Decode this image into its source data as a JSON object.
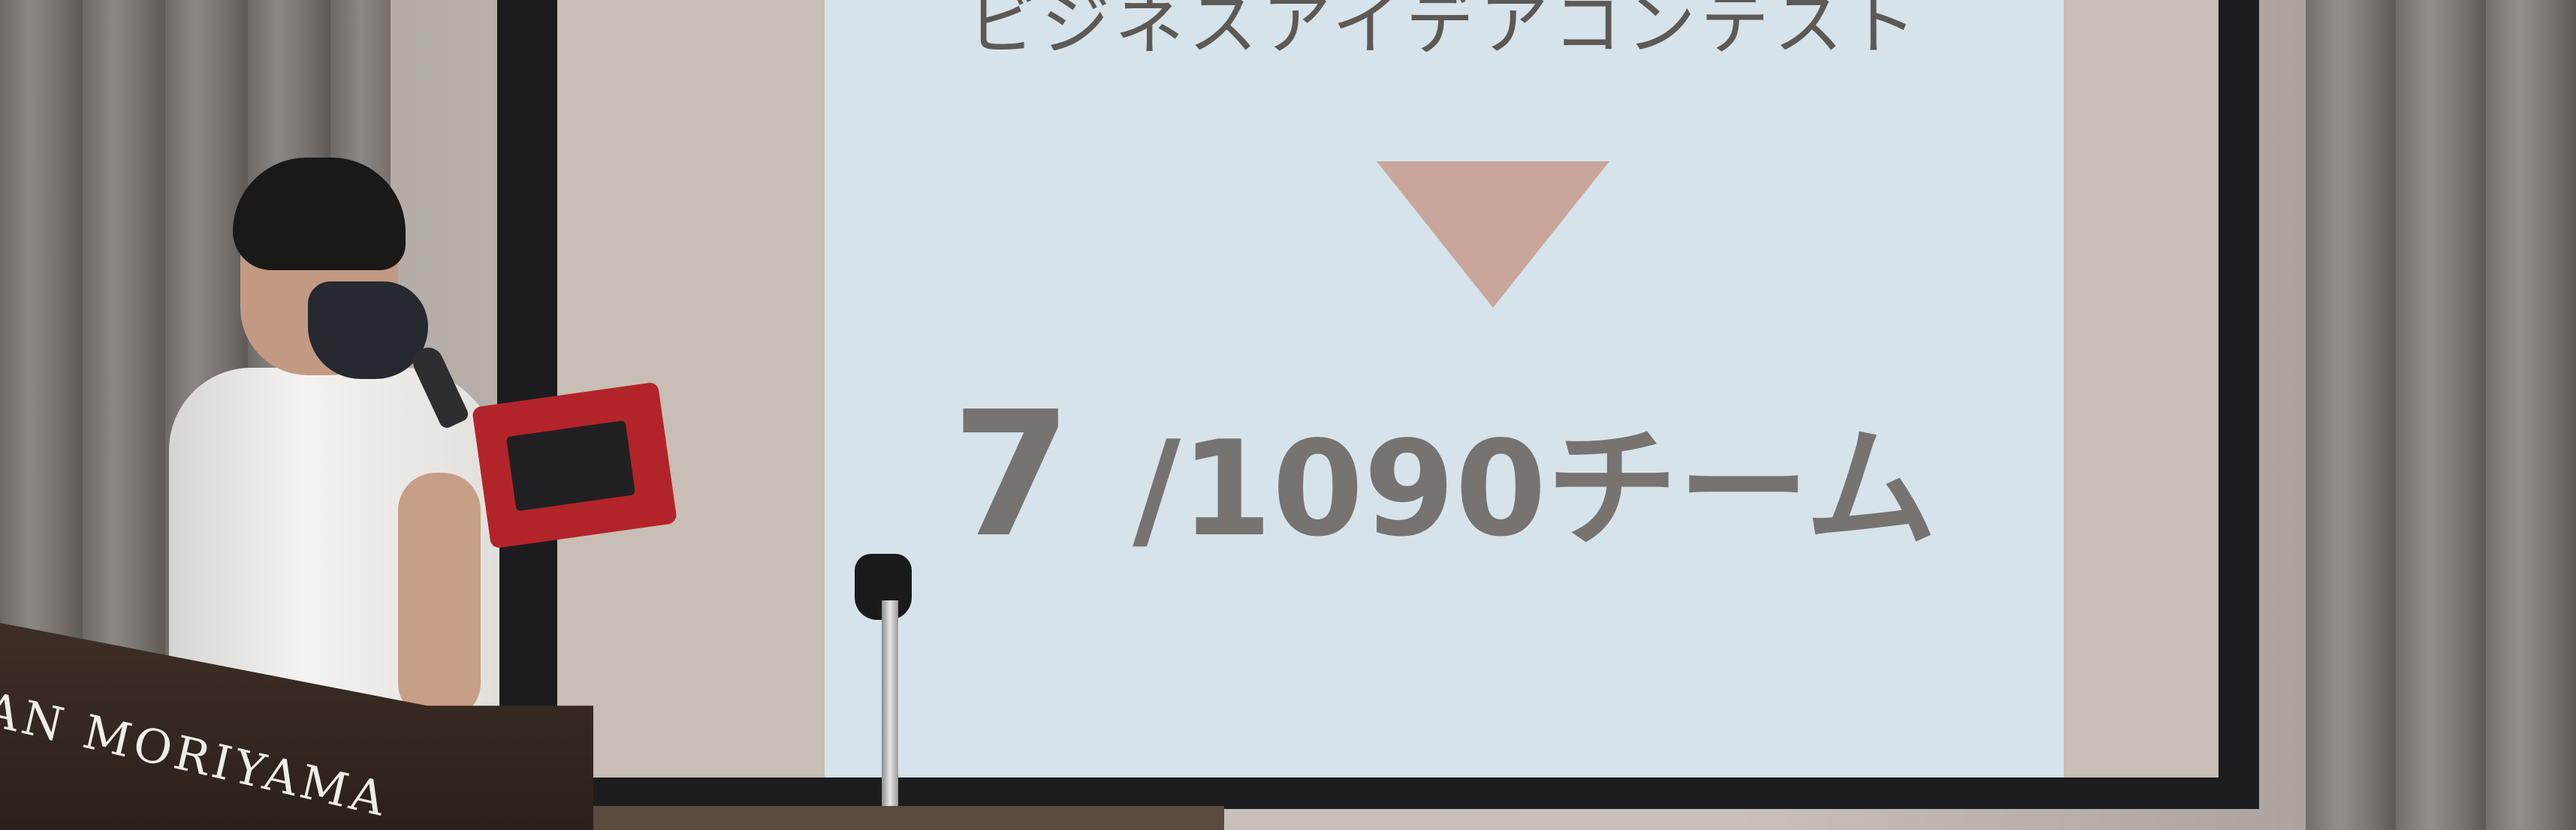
{
  "slide": {
    "heading": "ビジネスアイデアコンテスト",
    "result_rank": "7",
    "result_total": " /1090チーム"
  },
  "podium": {
    "label": "AN MORIYAMA"
  },
  "colors": {
    "slide_background": "#d6e3ea",
    "triangle": "#c9a59b",
    "slide_text": "#777370",
    "screen_frame": "#1c1c1e",
    "podium": "#3e2f26"
  }
}
